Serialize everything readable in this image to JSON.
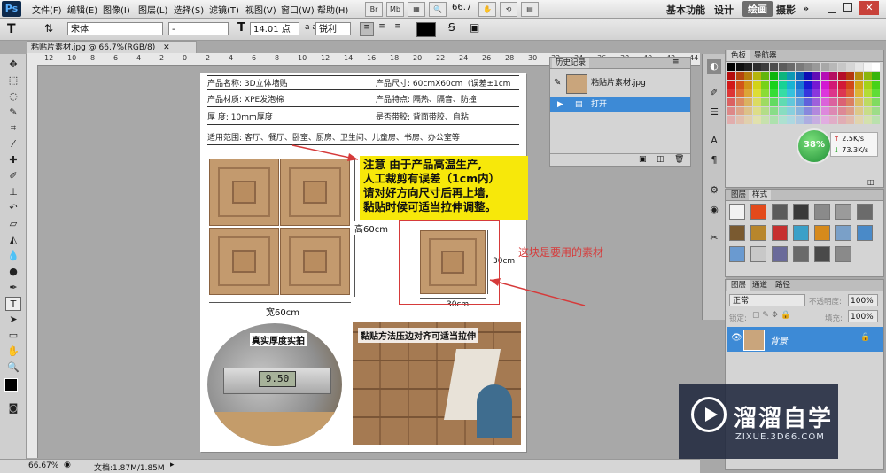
{
  "app": {
    "logo": "Ps",
    "workspace_tabs": [
      "基本功能",
      "设计",
      "绘画",
      "摄影"
    ],
    "active_workspace": "绘画",
    "search_arrow": "»"
  },
  "menu": {
    "items": [
      "文件(F)",
      "编辑(E)",
      "图像(I)",
      "图层(L)",
      "选择(S)",
      "滤镜(T)",
      "视图(V)",
      "窗口(W)",
      "帮助(H)"
    ],
    "zoom": "66.7"
  },
  "options": {
    "font_family": "宋体",
    "font_style": "-",
    "font_size": "14.01 点",
    "aa_label": "a a",
    "antialias": "锐利",
    "color": "#000000"
  },
  "document": {
    "tab_title": "粘贴片素材.jpg @ 66.7%(RGB/8)"
  },
  "ruler": {
    "h_marks": [
      "12",
      "10",
      "8",
      "6",
      "4",
      "2",
      "0",
      "2",
      "4",
      "6",
      "8",
      "10",
      "12",
      "14",
      "16",
      "18",
      "20",
      "22",
      "24",
      "26",
      "28",
      "30",
      "32",
      "34",
      "36",
      "38",
      "40",
      "42",
      "44"
    ]
  },
  "status": {
    "zoom": "66.67%",
    "doc_info": "文档:1.87M/1.85M"
  },
  "image": {
    "spec_rows": [
      {
        "l_label": "产品名称:",
        "l_value": "3D立体墙贴",
        "r_label": "产品尺寸:",
        "r_value": "60cmX60cm（误差±1cm"
      },
      {
        "l_label": "产品材质:",
        "l_value": "XPE发泡棉",
        "r_label": "产品特点:",
        "r_value": "隔热、隔音、防撞"
      },
      {
        "l_label": "厚    度:",
        "l_value": "10mm厚度",
        "r_label": "是否带胶:",
        "r_value": "背面带胶、自粘"
      }
    ],
    "scope_label": "适用范围:",
    "scope_value": "客厅、餐厅、卧室、厨房、卫生间、儿童房、书房、办公室等",
    "notice_lines": [
      "注意 由于产品高温生产,",
      "人工裁剪有误差（1cm内）",
      "请对好方向尺寸后再上墙,",
      "黏贴时候可适当拉伸调整。"
    ],
    "height_label": "高60cm",
    "width_label": "宽60cm",
    "small_h_label": "30cm",
    "small_w_label": "30cm",
    "thickness_label": "真实厚度实拍",
    "caliper_value": "9.50",
    "method_label": "黏贴方法压边对齐可适当拉伸",
    "annotation": "这块是要用的素材"
  },
  "history": {
    "tab": "历史记录",
    "snapshot": "粘贴片素材.jpg",
    "step": "打开"
  },
  "swatches_panel": {
    "tabs": [
      "色板",
      "导航器"
    ],
    "net_percent": "38%",
    "up_speed": "2.5K/s",
    "down_speed": "73.3K/s"
  },
  "styles_panel": {
    "tabs": [
      "图层",
      "样式"
    ]
  },
  "layers": {
    "tabs": [
      "图层",
      "通道",
      "路径"
    ],
    "blend_mode": "正常",
    "opacity_label": "不透明度:",
    "opacity": "100%",
    "lock_label": "锁定:",
    "fill_label": "填充:",
    "fill": "100%",
    "layer_name": "背景"
  },
  "watermark": {
    "brand": "溜溜自学",
    "url": "ZIXUE.3D66.COM"
  }
}
